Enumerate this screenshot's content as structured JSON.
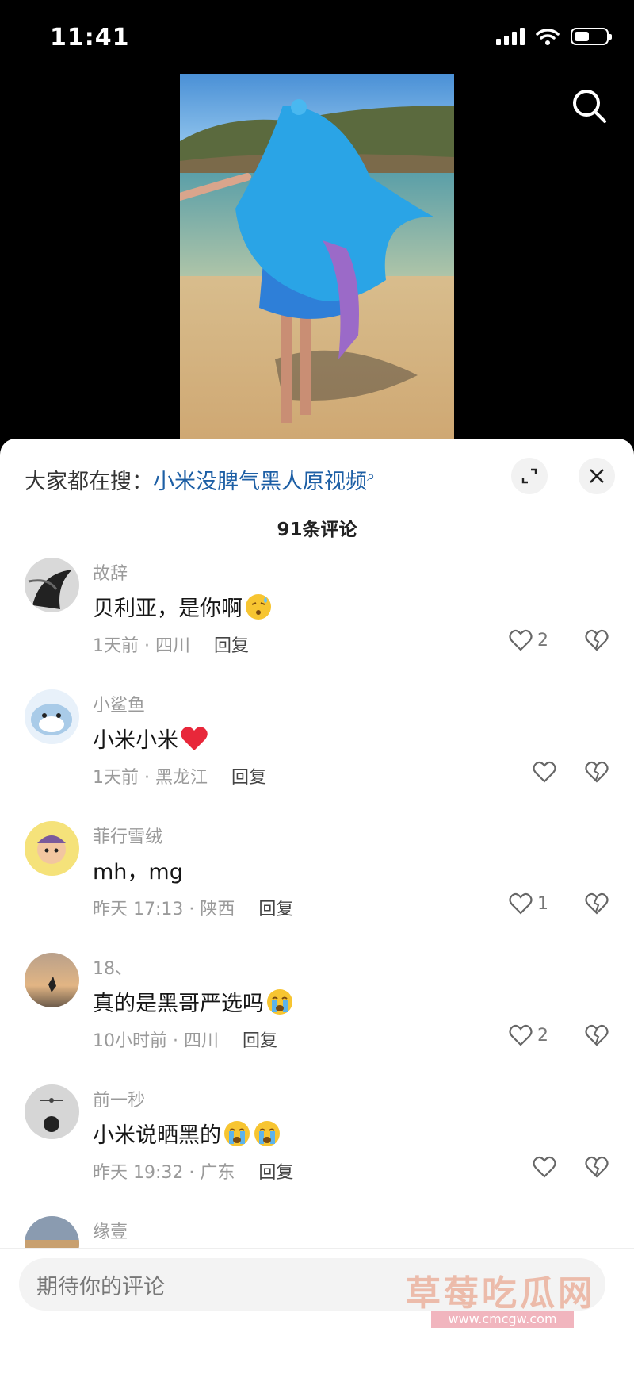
{
  "status": {
    "time": "11:41"
  },
  "sheet": {
    "suggest_prefix": "大家都在搜：",
    "suggest_query": "小米没脾气黑人原视频",
    "comment_count": "91条评论"
  },
  "comments": [
    {
      "name": "故辞",
      "text": "贝利亚，是你啊",
      "emoji": "face-sweat",
      "time": "1天前 · 四川",
      "reply": "回复",
      "likes": "2"
    },
    {
      "name": "小鲨鱼",
      "text": "小米小米",
      "emoji": "red-heart",
      "time": "1天前 · 黑龙江",
      "reply": "回复",
      "likes": ""
    },
    {
      "name": "菲行雪绒",
      "text": "mh，mg",
      "emoji": "",
      "time": "昨天 17:13 · 陕西",
      "reply": "回复",
      "likes": "1"
    },
    {
      "name": "18、",
      "text": "真的是黑哥严选吗",
      "emoji": "crying-face",
      "time": "10小时前 · 四川",
      "reply": "回复",
      "likes": "2"
    },
    {
      "name": "前一秒",
      "text": "小米说晒黑的",
      "emoji": "crying-face x2",
      "time": "昨天 19:32 · 广东",
      "reply": "回复",
      "likes": ""
    },
    {
      "name": "缘壹"
    }
  ],
  "input": {
    "placeholder": "期待你的评论"
  },
  "watermark": {
    "text": "草莓吃瓜网",
    "url": "www.cmcgw.com"
  },
  "colors": {
    "link": "#1d5fa5",
    "heart": "#e8273a",
    "muted": "#9a9a9a"
  }
}
